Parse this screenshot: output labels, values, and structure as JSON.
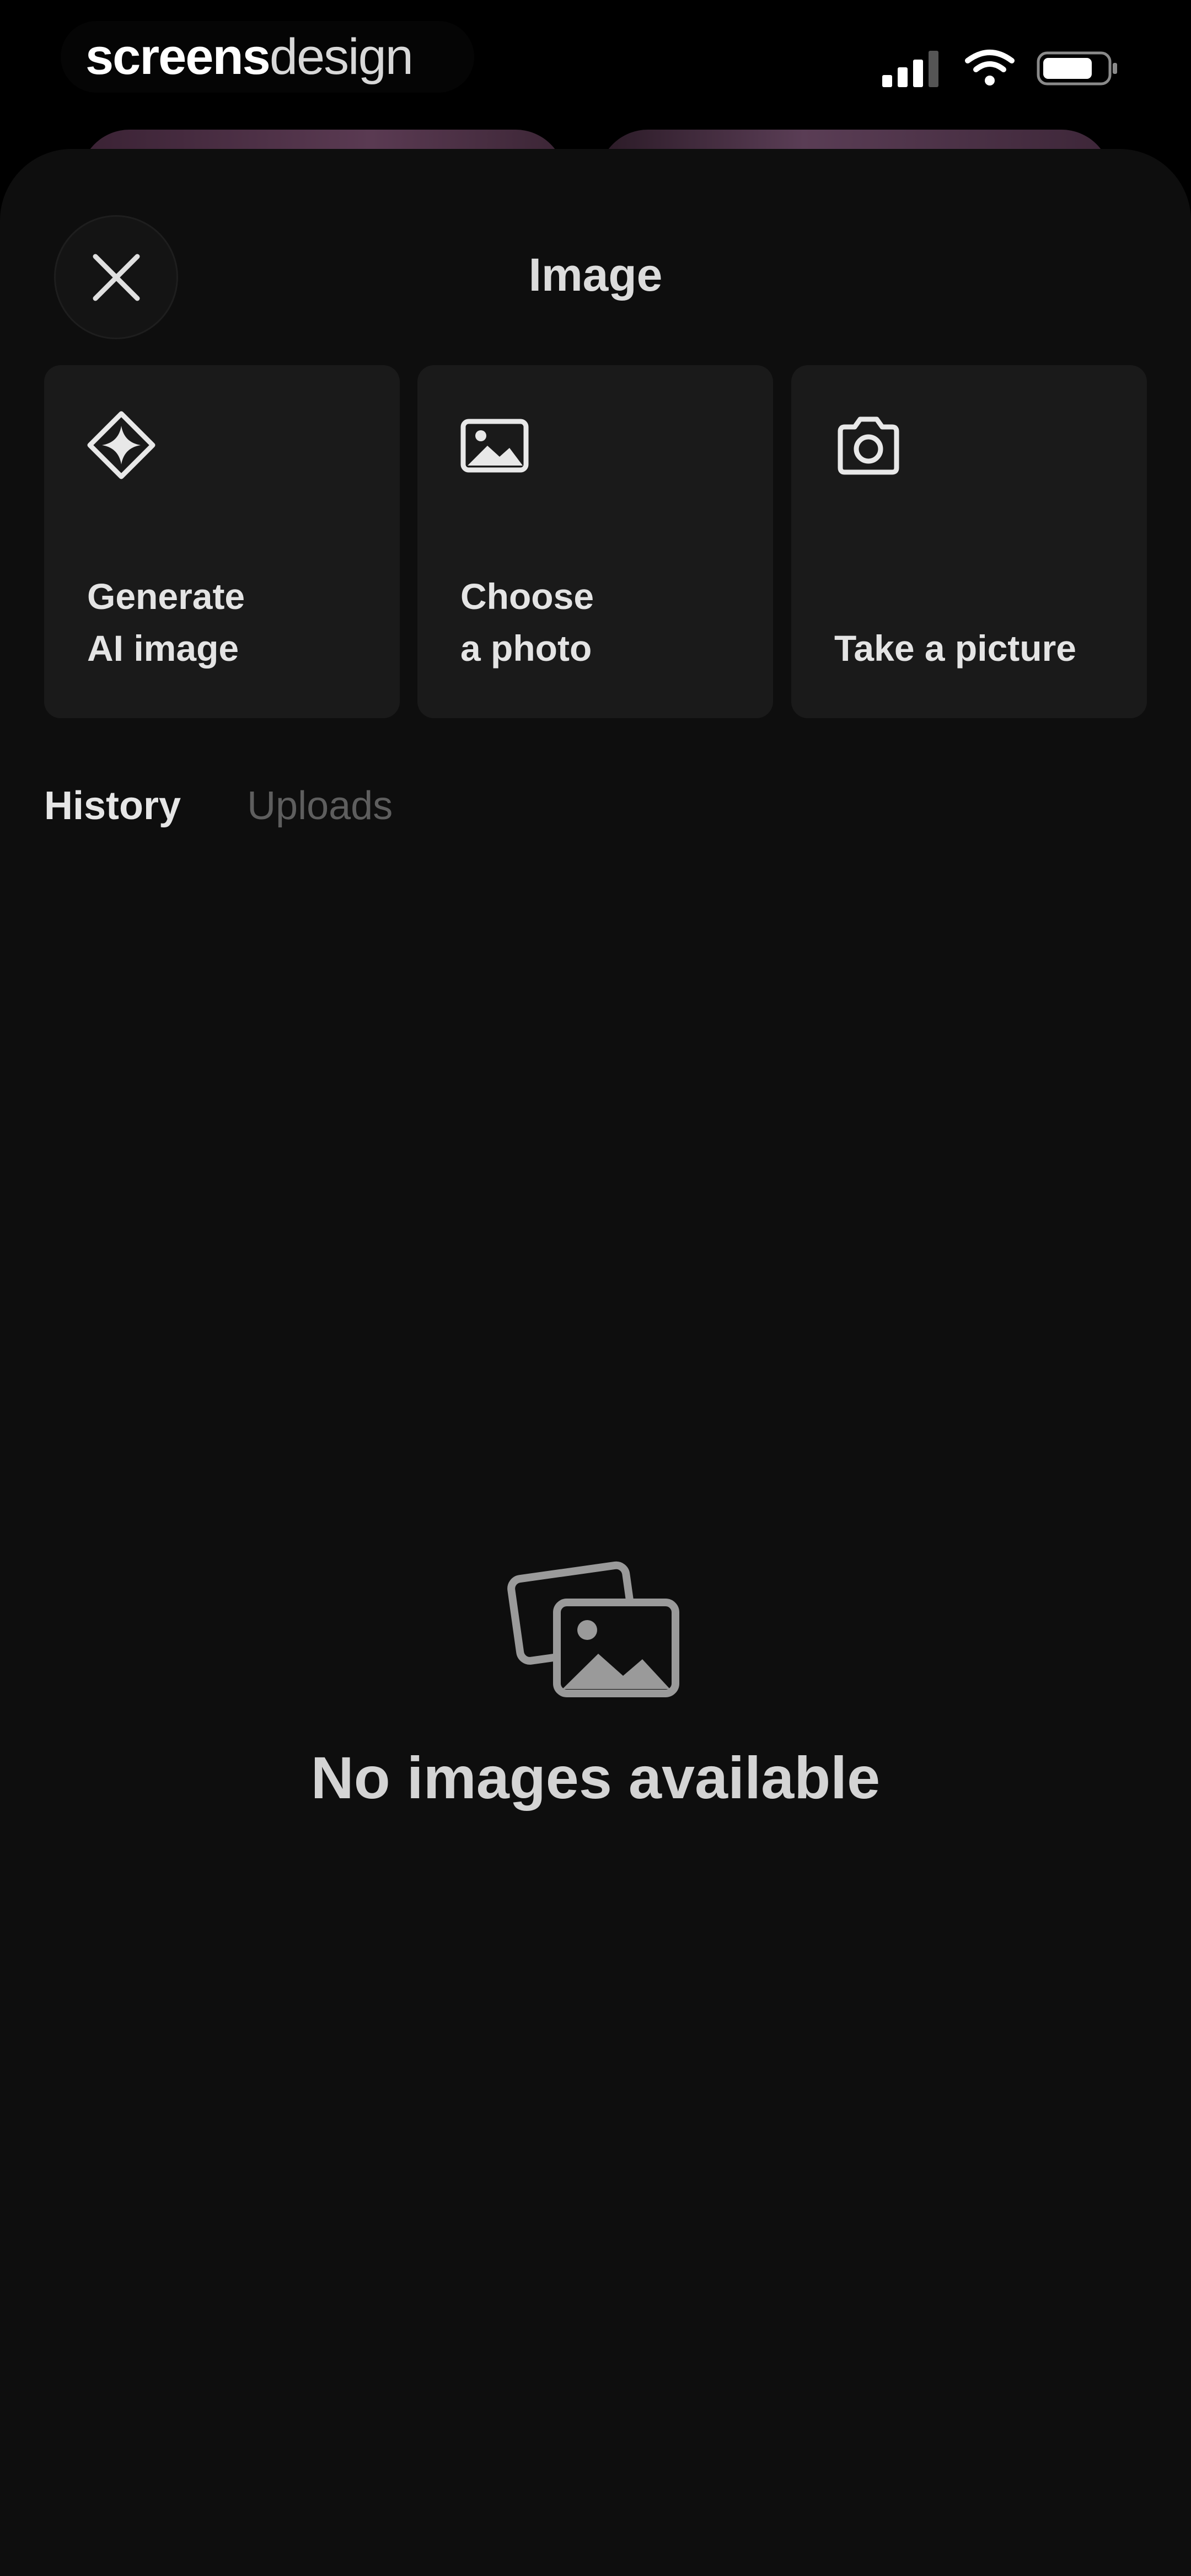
{
  "status_bar": {
    "brand_strong": "screens",
    "brand_light": "design",
    "icons": [
      "signal-icon",
      "wifi-icon",
      "battery-icon"
    ]
  },
  "sheet": {
    "title": "Image",
    "close_icon": "close-icon"
  },
  "options": [
    {
      "icon": "ai-sparkle-icon",
      "label": "Generate\nAI image"
    },
    {
      "icon": "photo-icon",
      "label": "Choose\na photo"
    },
    {
      "icon": "camera-icon",
      "label": "Take a picture"
    }
  ],
  "tabs": [
    {
      "label": "History",
      "active": true
    },
    {
      "label": "Uploads",
      "active": false
    }
  ],
  "empty_state": {
    "icon": "images-stack-icon",
    "text": "No images available"
  },
  "colors": {
    "background": "#0e0e0e",
    "card": "#1a1a1a",
    "text_primary": "#e4e4e4",
    "text_muted": "#5e5e5e"
  }
}
